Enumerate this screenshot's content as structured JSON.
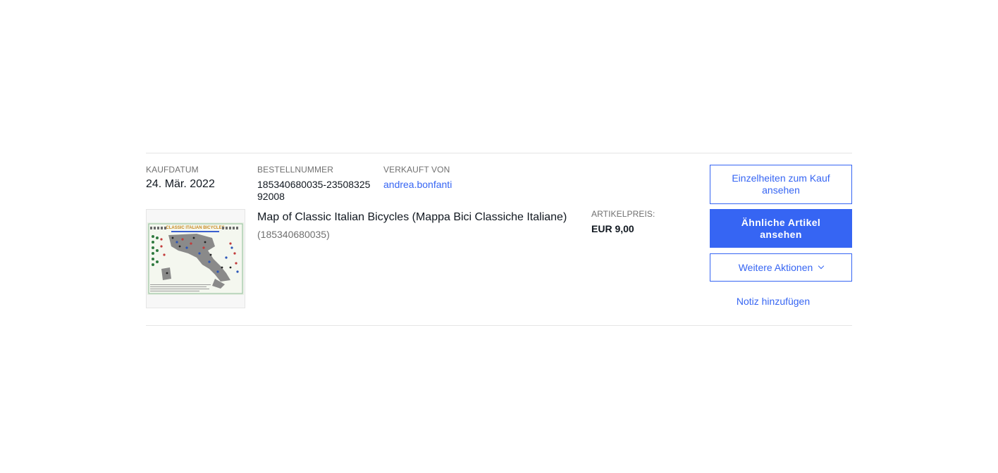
{
  "order": {
    "purchase_date_label": "KAUFDATUM",
    "purchase_date": "24. Mär. 2022",
    "order_number_label": "BESTELLNUMMER",
    "order_number": "185340680035-2350832592008",
    "seller_label": "VERKAUFT VON",
    "seller": "andrea.bonfanti"
  },
  "item": {
    "title": "Map of Classic Italian Bicycles (Mappa Bici Classiche Italiane)",
    "item_id": "(185340680035)",
    "price_label": "ARTIKELPREIS:",
    "price": "EUR 9,00",
    "thumbnail_heading": "CLASSIC ITALIAN BICYCLES"
  },
  "actions": {
    "details_label": "Einzelheiten zum Kauf ansehen",
    "similar_label": "Ähnliche Artikel ansehen",
    "more_label": "Weitere Aktionen",
    "note_label": "Notiz hinzufügen"
  },
  "colors": {
    "accent": "#3665f3",
    "muted_text": "#707070",
    "divider": "#e5e5e5"
  }
}
